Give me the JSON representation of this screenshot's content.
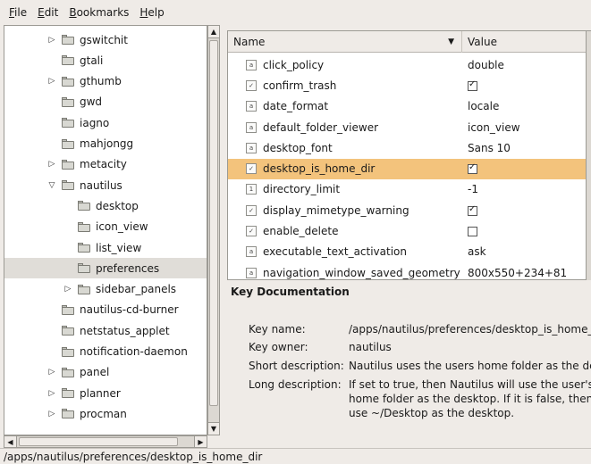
{
  "menubar": {
    "items": [
      {
        "accel": "F",
        "rest": "ile"
      },
      {
        "accel": "E",
        "rest": "dit"
      },
      {
        "accel": "B",
        "rest": "ookmarks"
      },
      {
        "accel": "H",
        "rest": "elp"
      }
    ]
  },
  "tree": {
    "items": [
      {
        "label": "gswitchit",
        "depth": 1,
        "expander": "collapsed"
      },
      {
        "label": "gtali",
        "depth": 1,
        "expander": "none"
      },
      {
        "label": "gthumb",
        "depth": 1,
        "expander": "collapsed"
      },
      {
        "label": "gwd",
        "depth": 1,
        "expander": "none"
      },
      {
        "label": "iagno",
        "depth": 1,
        "expander": "none"
      },
      {
        "label": "mahjongg",
        "depth": 1,
        "expander": "none"
      },
      {
        "label": "metacity",
        "depth": 1,
        "expander": "collapsed"
      },
      {
        "label": "nautilus",
        "depth": 1,
        "expander": "expanded"
      },
      {
        "label": "desktop",
        "depth": 2,
        "expander": "none"
      },
      {
        "label": "icon_view",
        "depth": 2,
        "expander": "none"
      },
      {
        "label": "list_view",
        "depth": 2,
        "expander": "none"
      },
      {
        "label": "preferences",
        "depth": 2,
        "expander": "none",
        "selected": true
      },
      {
        "label": "sidebar_panels",
        "depth": 2,
        "expander": "collapsed"
      },
      {
        "label": "nautilus-cd-burner",
        "depth": 1,
        "expander": "none"
      },
      {
        "label": "netstatus_applet",
        "depth": 1,
        "expander": "none"
      },
      {
        "label": "notification-daemon",
        "depth": 1,
        "expander": "none"
      },
      {
        "label": "panel",
        "depth": 1,
        "expander": "collapsed"
      },
      {
        "label": "planner",
        "depth": 1,
        "expander": "collapsed"
      },
      {
        "label": "procman",
        "depth": 1,
        "expander": "collapsed"
      }
    ]
  },
  "keys": {
    "header": {
      "name": "Name",
      "value": "Value"
    },
    "rows": [
      {
        "name": "click_policy",
        "type": "string",
        "value": "double"
      },
      {
        "name": "confirm_trash",
        "type": "bool",
        "checked": true
      },
      {
        "name": "date_format",
        "type": "string",
        "value": "locale"
      },
      {
        "name": "default_folder_viewer",
        "type": "string",
        "value": "icon_view"
      },
      {
        "name": "desktop_font",
        "type": "string",
        "value": "Sans 10"
      },
      {
        "name": "desktop_is_home_dir",
        "type": "bool",
        "checked": true,
        "selected": true
      },
      {
        "name": "directory_limit",
        "type": "int",
        "value": "-1"
      },
      {
        "name": "display_mimetype_warning",
        "type": "bool",
        "checked": true
      },
      {
        "name": "enable_delete",
        "type": "bool",
        "checked": false
      },
      {
        "name": "executable_text_activation",
        "type": "string",
        "value": "ask"
      },
      {
        "name": "navigation_window_saved_geometry",
        "type": "string",
        "value": "800x550+234+81"
      }
    ]
  },
  "doc": {
    "title": "Key Documentation",
    "key_name_label": "Key name:",
    "key_name": "/apps/nautilus/preferences/desktop_is_home_",
    "key_owner_label": "Key owner:",
    "key_owner": "nautilus",
    "short_desc_label": "Short description:",
    "short_desc": "Nautilus uses the users home folder as the de",
    "long_desc_label": "Long description:",
    "long_desc_lines": [
      "If set to true, then Nautilus will use the user's",
      "home folder as the desktop. If it is false, then",
      "use ~/Desktop as the desktop."
    ]
  },
  "status": {
    "path": "/apps/nautilus/preferences/desktop_is_home_dir"
  },
  "icons": {
    "string_type": "a",
    "int_type": "1",
    "bool_type": "✓",
    "expander_collapsed": "▷",
    "expander_expanded": "▽",
    "sort_desc": "▼"
  }
}
